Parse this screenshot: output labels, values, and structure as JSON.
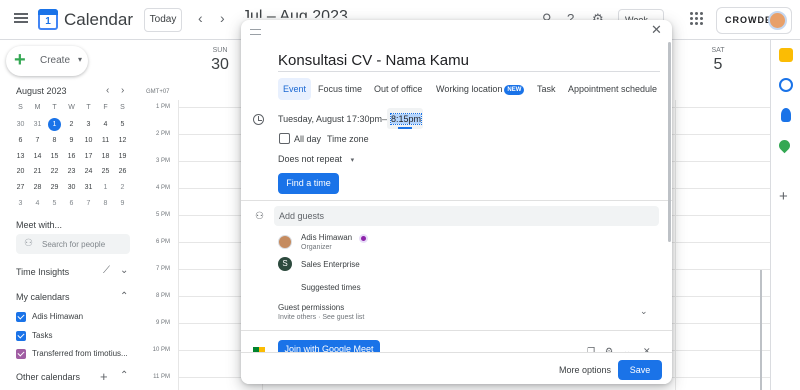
{
  "header": {
    "app_title": "Calendar",
    "logo_day": "1",
    "today_label": "Today",
    "prev_icon": "‹",
    "next_icon": "›",
    "date_range": "Jul – Aug 2023",
    "view_label": "Week",
    "brand_name": "CROWDE"
  },
  "sidebar": {
    "create_label": "Create",
    "mini_calendar": {
      "month_label": "August 2023",
      "weekday_heads": [
        "S",
        "M",
        "T",
        "W",
        "T",
        "F",
        "S"
      ],
      "weeks": [
        [
          "30",
          "31",
          "1",
          "2",
          "3",
          "4",
          "5"
        ],
        [
          "6",
          "7",
          "8",
          "9",
          "10",
          "11",
          "12"
        ],
        [
          "13",
          "14",
          "15",
          "16",
          "17",
          "18",
          "19"
        ],
        [
          "20",
          "21",
          "22",
          "23",
          "24",
          "25",
          "26"
        ],
        [
          "27",
          "28",
          "29",
          "30",
          "31",
          "1",
          "2"
        ],
        [
          "3",
          "4",
          "5",
          "6",
          "7",
          "8",
          "9"
        ]
      ],
      "today": "1"
    },
    "meet_with_label": "Meet with...",
    "search_people_placeholder": "Search for people",
    "time_insights_label": "Time Insights",
    "my_calendars_label": "My calendars",
    "calendars": [
      {
        "label": "Adis Himawan",
        "color": "#1a73e8"
      },
      {
        "label": "Tasks",
        "color": "#1a73e8"
      },
      {
        "label": "Transferred from timotius...",
        "color": "#a05da3"
      }
    ],
    "other_calendars_label": "Other calendars"
  },
  "grid": {
    "timezone": "GMT+07",
    "day_heads": [
      {
        "name": "SUN",
        "num": "30"
      },
      {
        "name": "SAT",
        "num": "5"
      }
    ],
    "hours": [
      "1 PM",
      "2 PM",
      "3 PM",
      "4 PM",
      "5 PM",
      "6 PM",
      "7 PM",
      "8 PM",
      "9 PM",
      "10 PM",
      "11 PM"
    ]
  },
  "dialog": {
    "title": "Konsultasi CV - Nama Kamu",
    "tabs": [
      {
        "label": "Event",
        "active": true
      },
      {
        "label": "Focus time"
      },
      {
        "label": "Out of office"
      },
      {
        "label": "Working location",
        "badge": "NEW"
      },
      {
        "label": "Task"
      },
      {
        "label": "Appointment schedule"
      }
    ],
    "date": "Tuesday, August 1",
    "start_time": "7:30pm",
    "dash": "–",
    "end_time": "8:15pm",
    "all_day_label": "All day",
    "time_zone_label": "Time zone",
    "repeat_label": "Does not repeat",
    "find_time_label": "Find a time",
    "add_guests_placeholder": "Add guests",
    "guests": [
      {
        "name": "Adis Himawan",
        "role": "Organizer"
      },
      {
        "name": "Sales Enterprise",
        "initial": "S"
      }
    ],
    "suggested_times_label": "Suggested times",
    "guest_permissions_label": "Guest permissions",
    "guest_permissions_sub": "Invite others · See guest list",
    "meet_button_label": "Join with Google Meet",
    "more_options_label": "More options",
    "save_label": "Save"
  },
  "colors": {
    "accent": "#1a73e8",
    "tab_active_bg": "#e8f0fe",
    "organizer_badge": "#8e24aa",
    "sales_avatar": "#2d4a3e"
  }
}
